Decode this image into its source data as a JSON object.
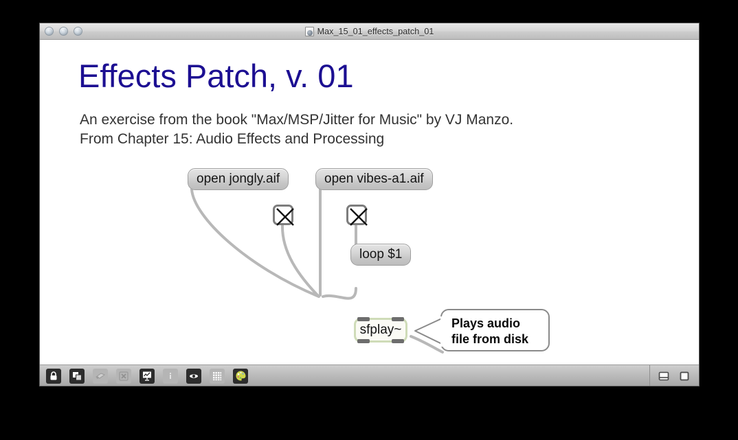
{
  "window": {
    "title": "Max_15_01_effects_patch_01",
    "doc_icon": "max-document-icon",
    "traffic_lights": [
      "close-button",
      "minimize-button",
      "zoom-button"
    ]
  },
  "patch": {
    "heading": "Effects Patch, v. 01",
    "heading_color": "#1c0f92",
    "description": "An exercise from the book \"Max/MSP/Jitter for Music\" by VJ Manzo.\nFrom Chapter 15: Audio Effects and Processing",
    "objects": {
      "message_open_jongly": "open jongly.aif",
      "message_open_vibes": "open vibes-a1.aif",
      "message_loop": "loop $1",
      "object_sfplay": "sfplay~",
      "toggle_left": "toggle-x-icon",
      "toggle_right": "toggle-x-icon"
    },
    "comment": {
      "text": "Plays audio\nfile from disk"
    }
  },
  "toolbar": {
    "left_items": [
      {
        "name": "lock-icon",
        "label": "Lock / Unlock patcher"
      },
      {
        "name": "presentation-icon",
        "label": "Presentation mode"
      },
      {
        "name": "view-icon",
        "label": "Patcher view"
      },
      {
        "name": "close-x-icon",
        "label": "Close"
      },
      {
        "name": "easel-icon",
        "label": "Object explorer"
      },
      {
        "name": "info-icon",
        "label": "Inspector info"
      },
      {
        "name": "inspector-icon",
        "label": "Object inspector"
      },
      {
        "name": "grid-icon",
        "label": "Snap to grid"
      },
      {
        "name": "palette-icon",
        "label": "Color palette"
      }
    ],
    "right_items": [
      {
        "name": "split-view-icon",
        "label": "Split view"
      },
      {
        "name": "single-view-icon",
        "label": "Single view"
      }
    ]
  }
}
